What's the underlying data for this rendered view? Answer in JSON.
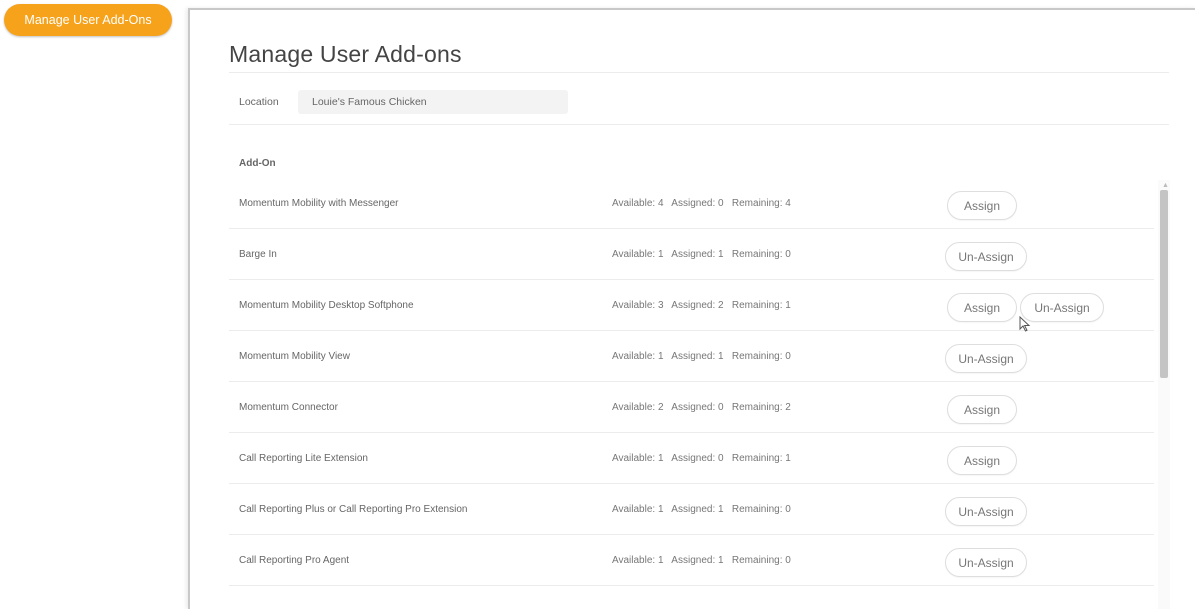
{
  "top_button": {
    "label": "Manage User Add-Ons"
  },
  "page": {
    "title": "Manage User Add-ons",
    "location_label": "Location",
    "location_value": "Louie's Famous Chicken",
    "column_header": "Add-On"
  },
  "addons": [
    {
      "name": "Momentum Mobility with Messenger",
      "stats": "Available: 4   Assigned: 0   Remaining: 4",
      "buttons": [
        "Assign"
      ]
    },
    {
      "name": "Barge In",
      "stats": "Available: 1   Assigned: 1   Remaining: 0",
      "buttons": [
        "Un-Assign"
      ]
    },
    {
      "name": "Momentum Mobility Desktop Softphone",
      "stats": "Available: 3   Assigned: 2   Remaining: 1",
      "buttons": [
        "Assign",
        "Un-Assign"
      ]
    },
    {
      "name": "Momentum Mobility View",
      "stats": "Available: 1   Assigned: 1   Remaining: 0",
      "buttons": [
        "Un-Assign"
      ]
    },
    {
      "name": "Momentum Connector",
      "stats": "Available: 2   Assigned: 0   Remaining: 2",
      "buttons": [
        "Assign"
      ]
    },
    {
      "name": "Call Reporting Lite Extension",
      "stats": "Available: 1   Assigned: 0   Remaining: 1",
      "buttons": [
        "Assign"
      ]
    },
    {
      "name": "Call Reporting Plus or Call Reporting Pro Extension",
      "stats": "Available: 1   Assigned: 1   Remaining: 0",
      "buttons": [
        "Un-Assign"
      ]
    },
    {
      "name": "Call Reporting Pro Agent",
      "stats": "Available: 1   Assigned: 1   Remaining: 0",
      "buttons": [
        "Un-Assign"
      ]
    }
  ],
  "colors": {
    "accent": "#f7a21b"
  },
  "icons": {
    "cursor": "mouse-pointer-icon",
    "scroll_up": "chevron-up-icon"
  }
}
